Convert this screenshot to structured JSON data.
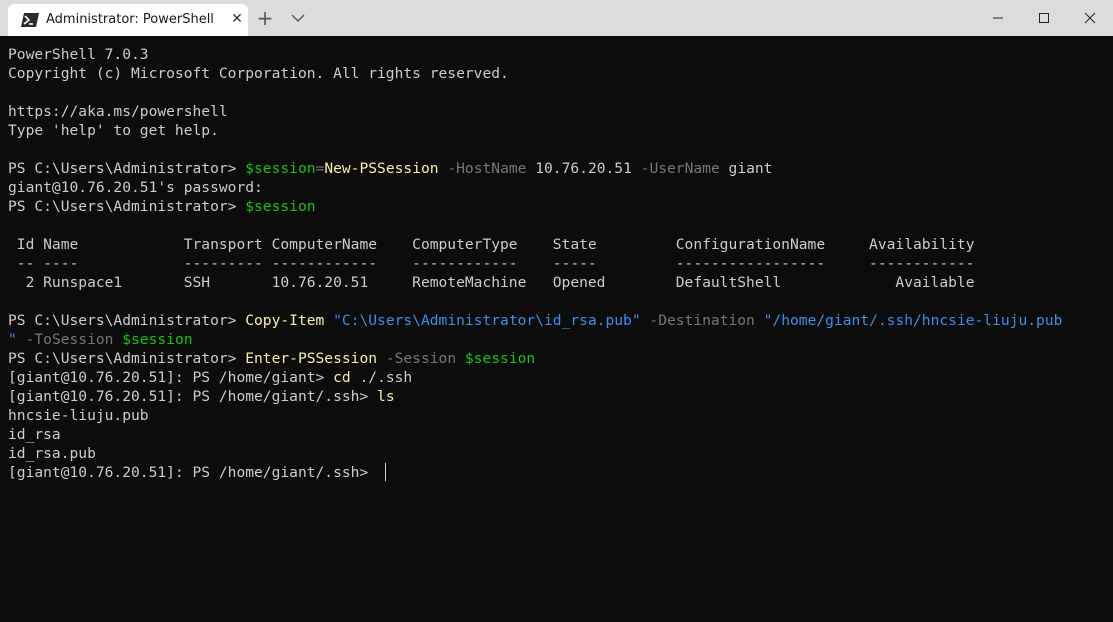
{
  "tab": {
    "title": "Administrator: PowerShell",
    "close": "✕",
    "new_tab": "+",
    "icon": "powershell-icon"
  },
  "window_controls": [
    "minimize-icon",
    "maximize-icon",
    "close-icon"
  ],
  "terminal": {
    "banner": {
      "version": "PowerShell 7.0.3",
      "copyright": "Copyright (c) Microsoft Corporation. All rights reserved.",
      "url": "https://aka.ms/powershell",
      "help": "Type 'help' to get help."
    },
    "cmd1": {
      "prompt": "PS C:\\Users\\Administrator> ",
      "var": "$session",
      "eq": "=",
      "cmdlet": "New-PSSession",
      "p1": " -HostName",
      "v1": " 10.76.20.51",
      "p2": " -UserName",
      "v2": " giant"
    },
    "password_line": "giant@10.76.20.51's password:",
    "cmd2": {
      "prompt": "PS C:\\Users\\Administrator> ",
      "var": "$session"
    },
    "table": {
      "header": " Id Name            Transport ComputerName    ComputerType    State         ConfigurationName     Availability",
      "separator": " -- ----            --------- ------------    ------------    -----         -----------------     ------------",
      "row": "  2 Runspace1       SSH       10.76.20.51     RemoteMachine   Opened        DefaultShell             Available"
    },
    "cmd3": {
      "prompt": "PS C:\\Users\\Administrator> ",
      "cmdlet": "Copy-Item",
      "arg1": " \"C:\\Users\\Administrator\\id_rsa.pub\"",
      "p1": " -Destination",
      "arg2": " \"/home/giant/.ssh/hncsie-liuju.pub",
      "arg2_cont": "\"",
      "p2": " -ToSession",
      "var": " $session"
    },
    "cmd4": {
      "prompt": "PS C:\\Users\\Administrator> ",
      "cmdlet": "Enter-PSSession",
      "p1": " -Session",
      "var": " $session"
    },
    "cmd5": {
      "prompt": "[giant@10.76.20.51]: PS /home/giant> ",
      "cmd": "cd",
      "arg": " ./.ssh"
    },
    "cmd6": {
      "prompt": "[giant@10.76.20.51]: PS /home/giant/.ssh> ",
      "cmd": "ls"
    },
    "ls_output": [
      "hncsie-liuju.pub",
      "id_rsa",
      "id_rsa.pub"
    ],
    "final_prompt": "[giant@10.76.20.51]: PS /home/giant/.ssh> "
  }
}
